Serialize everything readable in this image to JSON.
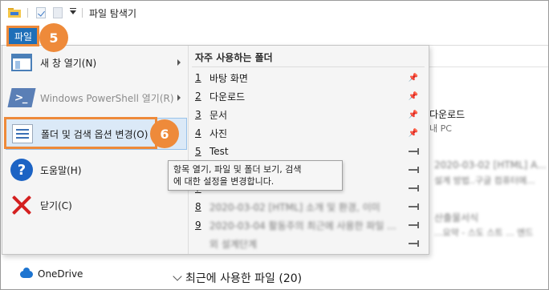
{
  "window": {
    "title": "파일 탐색기"
  },
  "ribbon": {
    "file_tab": "파일"
  },
  "file_menu": {
    "items": [
      {
        "label": "새 창 열기(N)",
        "icon": "new-window-icon",
        "has_submenu": true,
        "disabled": false
      },
      {
        "label": "Windows PowerShell 열기(R)",
        "icon": "powershell-icon",
        "has_submenu": true,
        "disabled": true
      },
      {
        "label": "폴더 및 검색 옵션 변경(O)",
        "icon": "folder-options-icon",
        "has_submenu": false,
        "disabled": false
      },
      {
        "label": "도움말(H)",
        "icon": "help-icon",
        "has_submenu": true,
        "disabled": false
      },
      {
        "label": "닫기(C)",
        "icon": "close-icon",
        "has_submenu": false,
        "disabled": false
      }
    ],
    "frequent": {
      "title": "자주 사용하는 폴더",
      "folders": [
        {
          "num": "1",
          "name": "바탕 화면",
          "pinned": true
        },
        {
          "num": "2",
          "name": "다운로드",
          "pinned": true
        },
        {
          "num": "3",
          "name": "문서",
          "pinned": true
        },
        {
          "num": "4",
          "name": "사진",
          "pinned": true
        },
        {
          "num": "5",
          "name": "Test",
          "pinned": false
        },
        {
          "num": "6",
          "name": "",
          "pinned": false
        },
        {
          "num": "7",
          "name": "",
          "pinned": false
        },
        {
          "num": "8",
          "name": "2020-03-02 [HTML] 소개 및 환경, 이미",
          "pinned": false
        },
        {
          "num": "9",
          "name": "2020-03-04 활동주의 최근에 사용한 파일 ...",
          "pinned": false
        },
        {
          "num": "",
          "name": "외 설계단계",
          "pinned": false
        }
      ]
    }
  },
  "tooltip": {
    "line1": "항목 열기, 파일 및 폴더 보기, 검색",
    "line2": "에 대한 설정을 변경합니다."
  },
  "callouts": {
    "badge5": "5",
    "badge6": "6"
  },
  "background": {
    "downloads_label": "다운로드",
    "this_pc_label": "내 PC",
    "blur1": "2020-03-02 [HTML] A...",
    "blur2": "설계 방법..구글 컴퓨터에...",
    "blur3": "산출물서식",
    "blur4": "...요약 - 스도 스트 ... 엔드",
    "onedrive": "OneDrive",
    "recent_header": "최근에 사용한 파일 (20)"
  },
  "colors": {
    "accent": "#1e6fb8",
    "callout": "#ee8a3a",
    "highlight": "#dbe9f7"
  }
}
